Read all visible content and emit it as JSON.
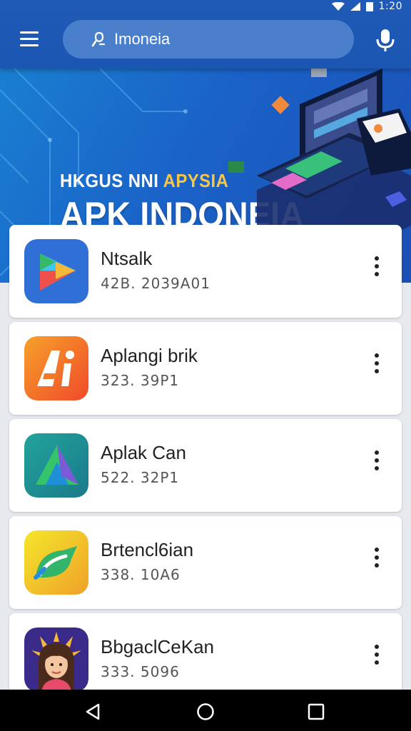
{
  "status_bar": {
    "time": "1:20",
    "wifi_icon": "wifi-icon",
    "signal_icon": "signal-icon",
    "battery_icon": "battery-icon"
  },
  "app_bar": {
    "menu_icon": "menu-icon",
    "search": {
      "value": "Imoneia",
      "icon": "search-icon"
    },
    "mic_icon": "mic-icon",
    "color": "#1e5ab6"
  },
  "banner": {
    "kicker_white": "HKGUS NNI ",
    "kicker_accent": "APYSIA",
    "title": "APK INDONEIA",
    "accent_color": "#f5c64a"
  },
  "apps": [
    {
      "name": "Ntsalk",
      "meta": "42B. 2039A01",
      "icon": "play-store-icon"
    },
    {
      "name": "Aplangi brik",
      "meta": "323. 39P1",
      "icon": "ai-app-icon"
    },
    {
      "name": "Aplak Can",
      "meta": "522. 32P1",
      "icon": "triangle-app-icon"
    },
    {
      "name": "Brtencl6ian",
      "meta": "338. 10A6",
      "icon": "leaf-app-icon"
    },
    {
      "name": "BbgaclCeKan",
      "meta": "333. 5096",
      "icon": "avatar-app-icon"
    }
  ],
  "nav_bar": {
    "back_icon": "back-icon",
    "home_icon": "home-icon",
    "recents_icon": "recents-icon"
  }
}
